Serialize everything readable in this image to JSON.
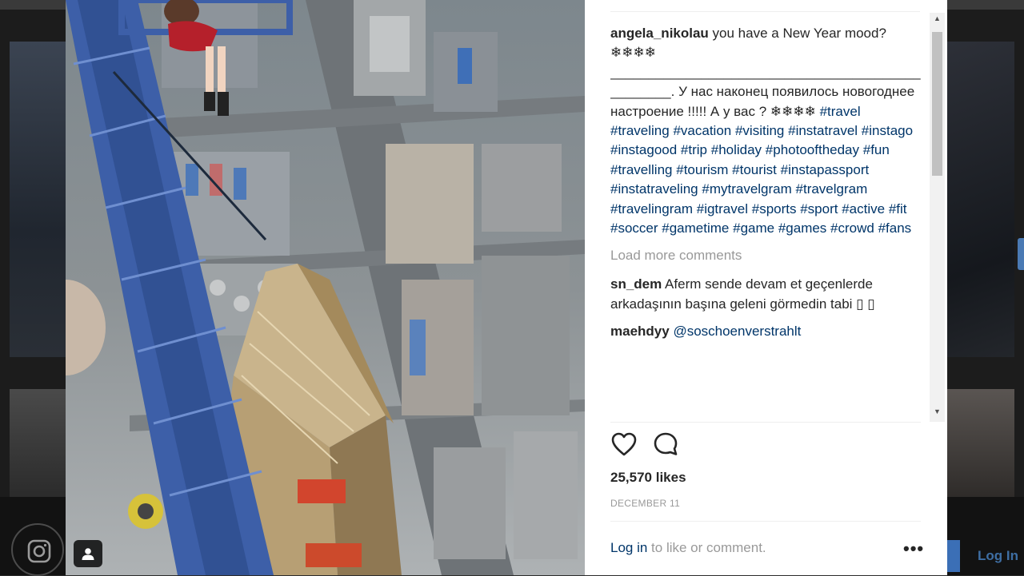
{
  "post": {
    "caption": {
      "username": "angela_nikolau",
      "text_parts": [
        {
          "t": " you have a New Year mood?❄❄❄❄ _________________________________________________. У нас наконец появилось новогоднее настроение !!!!! А у вас ? ❄❄❄❄ "
        },
        {
          "h": "#travel"
        },
        {
          "t": " "
        },
        {
          "h": "#traveling"
        },
        {
          "t": " "
        },
        {
          "h": "#vacation"
        },
        {
          "t": " "
        },
        {
          "h": "#visiting"
        },
        {
          "t": " "
        },
        {
          "h": "#instatravel"
        },
        {
          "t": " "
        },
        {
          "h": "#instago"
        },
        {
          "t": " "
        },
        {
          "h": "#instagood"
        },
        {
          "t": " "
        },
        {
          "h": "#trip"
        },
        {
          "t": " "
        },
        {
          "h": "#holiday"
        },
        {
          "t": " "
        },
        {
          "h": "#photooftheday"
        },
        {
          "t": " "
        },
        {
          "h": "#fun"
        },
        {
          "t": " "
        },
        {
          "h": "#travelling"
        },
        {
          "t": " "
        },
        {
          "h": "#tourism"
        },
        {
          "t": " "
        },
        {
          "h": "#tourist"
        },
        {
          "t": " "
        },
        {
          "h": "#instapassport"
        },
        {
          "t": " "
        },
        {
          "h": "#instatraveling"
        },
        {
          "t": " "
        },
        {
          "h": "#mytravelgram"
        },
        {
          "t": " "
        },
        {
          "h": "#travelgram"
        },
        {
          "t": " "
        },
        {
          "h": "#travelingram"
        },
        {
          "t": " "
        },
        {
          "h": "#igtravel"
        },
        {
          "t": " "
        },
        {
          "h": "#sports"
        },
        {
          "t": " "
        },
        {
          "h": "#sport"
        },
        {
          "t": " "
        },
        {
          "h": "#active"
        },
        {
          "t": " "
        },
        {
          "h": "#fit"
        },
        {
          "t": " "
        },
        {
          "h": "#soccer"
        },
        {
          "t": " "
        },
        {
          "h": "#gametime"
        },
        {
          "t": " "
        },
        {
          "h": "#game"
        },
        {
          "t": " "
        },
        {
          "h": "#games"
        },
        {
          "t": " "
        },
        {
          "h": "#crowd"
        },
        {
          "t": " "
        },
        {
          "h": "#fans"
        }
      ]
    },
    "load_more_label": "Load more comments",
    "comments": [
      {
        "username": "sn_dem",
        "text": "Aferm sende devam et geçenlerde arkadaşının başına geleni görmedin tabi ▯ ▯",
        "mention": ""
      },
      {
        "username": "maehdyy",
        "text": "",
        "mention": "@soschoenverstrahlt"
      }
    ],
    "likes": "25,570 likes",
    "date": "DECEMBER 11",
    "login_link": "Log in",
    "login_suffix": " to like or comment.",
    "more_icon": "•••"
  },
  "background_page": {
    "login_link": "Log In"
  },
  "icons": {
    "heart": "heart-icon",
    "comment": "comment-icon",
    "instagram": "instagram-icon",
    "user_tag": "user-tag-icon",
    "more": "more-options-icon"
  },
  "colors": {
    "hashtag": "#003569",
    "muted": "#999999",
    "text": "#262626"
  }
}
